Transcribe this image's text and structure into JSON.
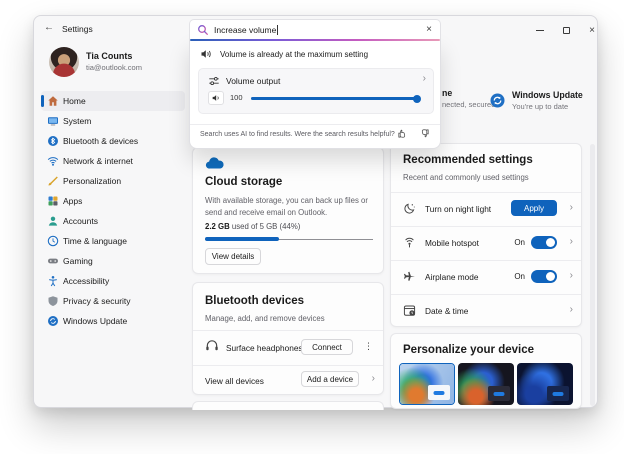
{
  "colors": {
    "accent": "#0F63BC",
    "window_bg": "#F7F7F8",
    "card_bg": "#FDFDFD"
  },
  "icons": {
    "back": "←",
    "close": "×",
    "chevron": "›",
    "more": "⋮"
  },
  "titlebar": {
    "title": "Settings"
  },
  "search": {
    "value": "Increase volume"
  },
  "dropdown": {
    "result_text": "Volume is already at the maximum setting",
    "volume_output_label": "Volume output",
    "volume_value": "100",
    "slider_percent": 100,
    "footer": "Search uses AI to find results. Were the search results helpful?"
  },
  "user": {
    "name": "Tia Counts",
    "email": "tia@outlook.com"
  },
  "sidebar": {
    "items": [
      {
        "label": "Home",
        "selected": true
      },
      {
        "label": "System"
      },
      {
        "label": "Bluetooth & devices"
      },
      {
        "label": "Network & internet"
      },
      {
        "label": "Personalization"
      },
      {
        "label": "Apps"
      },
      {
        "label": "Accounts"
      },
      {
        "label": "Time & language"
      },
      {
        "label": "Gaming"
      },
      {
        "label": "Accessibility"
      },
      {
        "label": "Privacy & security"
      },
      {
        "label": "Windows Update"
      }
    ]
  },
  "header": {
    "fragment_line1": "ne",
    "fragment_line2": "nected, secured",
    "update_title": "Windows Update",
    "update_status": "You're up to date"
  },
  "cloud": {
    "title": "Cloud storage",
    "description": "With available storage, you can back up files or send and receive email on Outlook.",
    "used_bold": "2.2 GB",
    "used_rest": " used of 5 GB (44%)",
    "percent_used": 44,
    "button": "View details"
  },
  "bluetooth": {
    "title": "Bluetooth devices",
    "subtitle": "Manage, add, and remove devices",
    "device_name": "Surface headphones",
    "connect_button": "Connect",
    "view_all": "View all devices",
    "add_button": "Add a device"
  },
  "recommended": {
    "title": "Recommended settings",
    "subtitle": "Recent and commonly used settings",
    "rows": [
      {
        "label": "Turn on night light",
        "button": "Apply"
      },
      {
        "label": "Mobile hotspot",
        "state": "On"
      },
      {
        "label": "Airplane mode",
        "state": "On"
      },
      {
        "label": "Date & time"
      }
    ]
  },
  "personalize": {
    "title": "Personalize your device"
  }
}
